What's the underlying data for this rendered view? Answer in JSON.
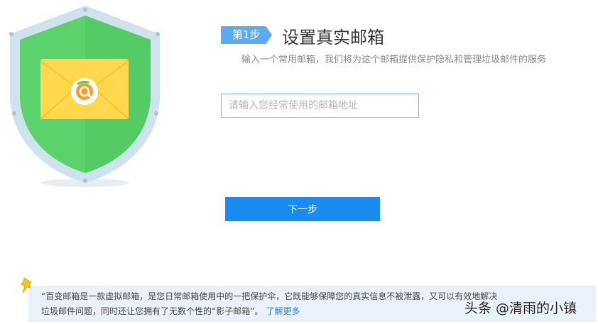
{
  "step": {
    "badge_label": "第1步",
    "title": "设置真实邮箱",
    "subtitle": "输入一个常用邮箱，我们将为这个邮箱提供保护隐私和管理垃圾邮件的服务"
  },
  "form": {
    "email_placeholder": "请输入您经常使用的邮箱地址",
    "email_value": "",
    "next_label": "下一步"
  },
  "notice": {
    "line1": "“百变邮箱是一款虚拟邮箱，是您日常邮箱使用中的一把保护伞，它既能够保障您的真实信息不被泄露，又可以有效地解决",
    "line2": "垃圾邮件问题，同时还让您拥有了无数个性的“影子邮箱”。",
    "learn_more": "了解更多"
  },
  "watermark": "头条 @清雨的小镇",
  "icons": [
    "shield-mail-illustration",
    "pin-icon"
  ],
  "colors": {
    "accent": "#1a8cf0",
    "badge": "#5aabf0",
    "shield_green": "#5cd26c",
    "envelope_yellow": "#ffd84d",
    "notice_bg": "#e9f2fa"
  }
}
